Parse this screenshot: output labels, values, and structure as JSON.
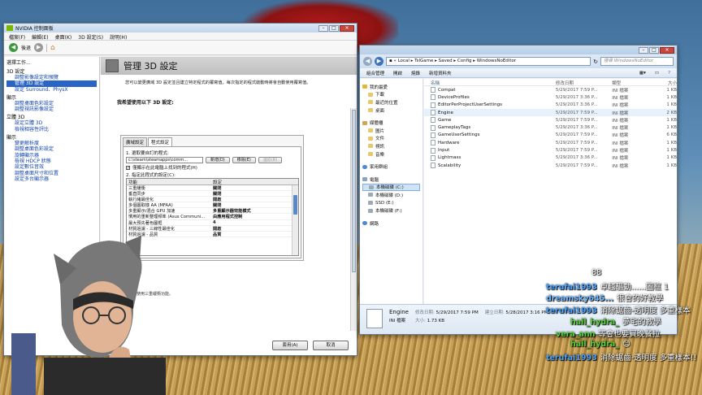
{
  "nvidia": {
    "title": "NVIDIA 控制面板",
    "menu": [
      "檔案(F)",
      "編輯(E)",
      "桌面(K)",
      "3D 設定(S)",
      "說明(H)"
    ],
    "back_label": "後退",
    "task_header": "選擇工作...",
    "tree": [
      {
        "group": "3D 設定",
        "items": [
          "調整影像設定和預覽",
          "管理 3D 設定",
          "設定 Surround、PhysX"
        ],
        "selected": 1
      },
      {
        "group": "顯示",
        "items": [
          "調整桌面色彩設定",
          "調整視訊影像設定"
        ]
      },
      {
        "group": "立體 3D",
        "items": [
          "設定立體 3D",
          "檢視相容性評比"
        ]
      },
      {
        "group": "顯示",
        "items": [
          "變更解析度",
          "調整桌面色彩設定",
          "旋轉顯示器",
          "檢視 HDCP 狀態",
          "設定數位音效",
          "調整桌面尺寸和位置",
          "設定多台顯示器"
        ]
      }
    ],
    "banner_title": "管理 3D 設定",
    "restore_label": "還原預設值",
    "description": "您可以變更廣域 3D 設定並且建立特定程式的覆寫值。每次指定的程式啟動時將會自動使用覆寫值。",
    "section_label": "我希望使用以下 3D 設定:",
    "tabs": [
      "廣域設定",
      "程式設定"
    ],
    "step1": "1. 選取要自訂的程式:",
    "program_value": "c:\\steam\\steamapps\\comm...",
    "add_label": "新增(D)",
    "remove_label": "移除(E)",
    "restore_btn": "還原(R)",
    "checkbox_label": "僅顯示在此電腦上找到的程式(H)",
    "step2": "2. 指定此程式的設定(C):",
    "col_feature": "功能",
    "col_setting": "設定",
    "settings": [
      [
        "三重緩衝",
        "關閉"
      ],
      [
        "垂直同步",
        "關閉"
      ],
      [
        "執行緒最佳化",
        "開啟"
      ],
      [
        "多個圖取樣 AA (MFAA)",
        "關閉"
      ],
      [
        "多重顯示/混合 GPU 加速",
        "多重顯示器效能模式"
      ],
      [
        "慣用的重新整理頻率 (Asus Communi...",
        "由應用程式控制"
      ],
      [
        "最大預先著色圖框",
        "4"
      ],
      [
        "材質過濾 - 三線性最佳化",
        "開啟"
      ],
      [
        "材質過濾 - 品質",
        "品質"
      ]
    ],
    "note": "說明:",
    "note_text": "當程式使用三重緩衝功能。",
    "apply_label": "套用(A)",
    "cancel_label": "取消"
  },
  "explorer": {
    "path": [
      "Local",
      "TslGame",
      "Saved",
      "Config",
      "WindowsNoEditor"
    ],
    "search_placeholder": "搜尋 WindowsNoEditor",
    "commands": [
      "組合管理",
      "開啟",
      "燒錄",
      "新增資料夾"
    ],
    "nav": [
      {
        "label": "我的最愛",
        "icon": "star-icon",
        "level": 0
      },
      {
        "label": "下載",
        "icon": "folder-icon",
        "level": 1
      },
      {
        "label": "最近的位置",
        "icon": "folder-icon",
        "level": 1
      },
      {
        "label": "桌面",
        "icon": "folder-icon",
        "level": 1
      },
      {
        "label": "",
        "icon": "",
        "level": -1
      },
      {
        "label": "媒體櫃",
        "icon": "library-icon",
        "level": 0
      },
      {
        "label": "圖片",
        "icon": "folder-icon",
        "level": 1
      },
      {
        "label": "文件",
        "icon": "folder-icon",
        "level": 1
      },
      {
        "label": "視訊",
        "icon": "folder-icon",
        "level": 1
      },
      {
        "label": "音樂",
        "icon": "folder-icon",
        "level": 1
      },
      {
        "label": "",
        "icon": "",
        "level": -1
      },
      {
        "label": "家用群組",
        "icon": "homegroup-icon",
        "level": 0
      },
      {
        "label": "",
        "icon": "",
        "level": -1
      },
      {
        "label": "電腦",
        "icon": "computer-icon",
        "level": 0
      },
      {
        "label": "本機磁碟 (C:)",
        "icon": "disk-icon",
        "level": 1
      },
      {
        "label": "本機磁碟 (D:)",
        "icon": "disk-icon",
        "level": 1
      },
      {
        "label": "SSD (E:)",
        "icon": "disk-icon",
        "level": 1
      },
      {
        "label": "本機磁碟 (F:)",
        "icon": "disk-icon",
        "level": 1
      },
      {
        "label": "",
        "icon": "",
        "level": -1
      },
      {
        "label": "網路",
        "icon": "network-icon",
        "level": 0
      }
    ],
    "nav_selected": 14,
    "columns": [
      "名稱",
      "修改日期",
      "類型",
      "大小"
    ],
    "files": [
      [
        "Compat",
        "5/29/2017 7:59 P...",
        "INI 檔案",
        "1 KB"
      ],
      [
        "DeviceProfiles",
        "5/29/2017 3:36 P...",
        "INI 檔案",
        "1 KB"
      ],
      [
        "EditorPerProjectUserSettings",
        "5/29/2017 3:36 P...",
        "INI 檔案",
        "1 KB"
      ],
      [
        "Engine",
        "5/29/2017 7:59 P...",
        "INI 檔案",
        "2 KB"
      ],
      [
        "Game",
        "5/29/2017 7:59 P...",
        "INI 檔案",
        "1 KB"
      ],
      [
        "GameplayTags",
        "5/29/2017 3:36 P...",
        "INI 檔案",
        "1 KB"
      ],
      [
        "GameUserSettings",
        "5/29/2017 7:59 P...",
        "INI 檔案",
        "6 KB"
      ],
      [
        "Hardware",
        "5/29/2017 7:59 P...",
        "INI 檔案",
        "1 KB"
      ],
      [
        "Input",
        "5/29/2017 7:59 P...",
        "INI 檔案",
        "1 KB"
      ],
      [
        "Lightmass",
        "5/29/2017 3:36 P...",
        "INI 檔案",
        "1 KB"
      ],
      [
        "Scalability",
        "5/29/2017 7:59 P...",
        "INI 檔案",
        "1 KB"
      ]
    ],
    "selected_file": 3,
    "details": {
      "name": "Engine",
      "type": "INI 檔案",
      "modified_label": "修改日期:",
      "modified": "5/29/2017 7:59 PM",
      "created_label": "建立日期:",
      "created": "5/28/2017 3:16 PM",
      "size_label": "大小:",
      "size": "1.73 KB"
    }
  },
  "chat": [
    {
      "user": "",
      "msg": "88",
      "color": "#ffffff"
    },
    {
      "user": "terufai1993",
      "msg": "卓越驅動......圖框 1",
      "color": "#4aa3ff"
    },
    {
      "user": "dreamsky645...",
      "msg": "很會的好教學",
      "color": "#6fb7ff"
    },
    {
      "user": "terufai1993",
      "msg": "消除鋸齒-透明度 多重樣本",
      "color": "#4aa3ff"
    },
    {
      "user": "hail_hydra_",
      "msg": "夢宅的教學",
      "color": "#56d13c"
    },
    {
      "user": "vera_ann",
      "msg": "等會也要買晚餐拉",
      "color": "#56d13c"
    },
    {
      "user": "hail_hydra_",
      "msg": "😊",
      "color": "#56d13c"
    },
    {
      "user": "terufai1993",
      "msg": "消除鋸齒-透明度 多重樣本!!",
      "color": "#4aa3ff"
    }
  ]
}
